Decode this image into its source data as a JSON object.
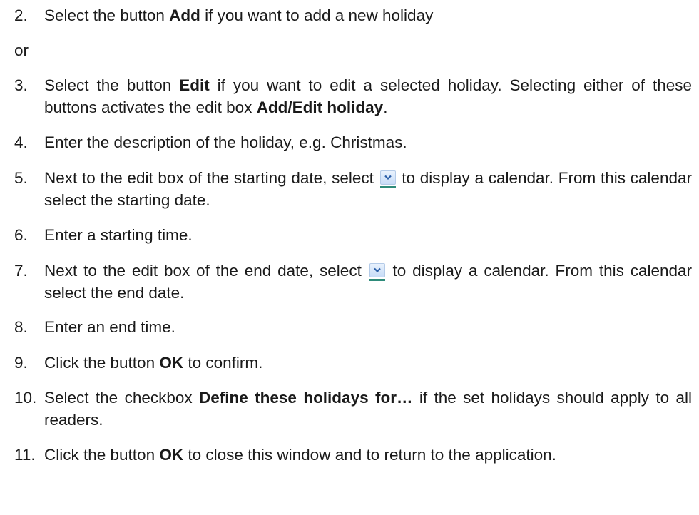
{
  "steps": [
    {
      "num": "2.",
      "before": "Select the button ",
      "bold": "Add",
      "after": " if you want to add a new holiday"
    },
    {
      "num": "3.",
      "before": "Select the button ",
      "bold": "Edit",
      "middle": " if you want to edit a selected holiday. Selecting either of these buttons activates the edit box ",
      "bold2": "Add/Edit holiday",
      "after": "."
    },
    {
      "num": "4.",
      "text": "Enter the description of the holiday, e.g. Christmas."
    },
    {
      "num": "5.",
      "before": "Next to the edit box of the starting date, select ",
      "after": " to display a calendar. From this calendar select the starting date."
    },
    {
      "num": "6.",
      "text": "Enter a starting time."
    },
    {
      "num": "7.",
      "before": "Next to the edit box of the end date, select ",
      "after": " to display a calendar. From this calendar select the end date."
    },
    {
      "num": "8.",
      "text": "Enter an end time."
    },
    {
      "num": "9.",
      "before": "Click the button ",
      "bold": "OK",
      "after": " to confirm."
    },
    {
      "num": "10.",
      "before": "Select the checkbox ",
      "bold": "Define these holidays for…",
      "after": " if the set holidays should apply to all readers."
    },
    {
      "num": "11.",
      "before": "Click the button ",
      "bold": "OK",
      "after": " to close this window and to return to the application."
    }
  ],
  "or_text": "or",
  "icons": {
    "dropdown": "chevron-down-icon",
    "dropdown_fill": "#c7dcf7",
    "dropdown_underline": "#2e8b7a",
    "chevron_color": "#2b5fa8"
  }
}
